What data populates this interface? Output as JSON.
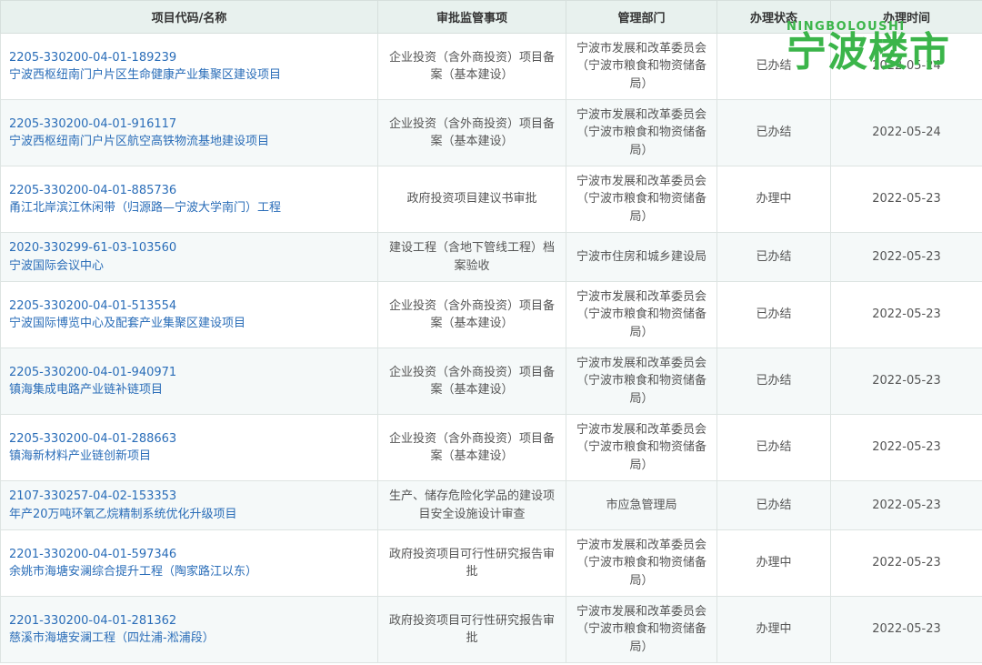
{
  "headers": [
    "项目代码/名称",
    "审批监管事项",
    "管理部门",
    "办理状态",
    "办理时间"
  ],
  "rows": [
    {
      "code": "2205-330200-04-01-189239",
      "name": "宁波西枢纽南门户片区生命健康产业集聚区建设项目",
      "item": "企业投资（含外商投资）项目备案（基本建设）",
      "dept": "宁波市发展和改革委员会（宁波市粮食和物资储备局）",
      "status": "已办结",
      "date": "2022-05-24"
    },
    {
      "code": "2205-330200-04-01-916117",
      "name": "宁波西枢纽南门户片区航空高铁物流基地建设项目",
      "item": "企业投资（含外商投资）项目备案（基本建设）",
      "dept": "宁波市发展和改革委员会（宁波市粮食和物资储备局）",
      "status": "已办结",
      "date": "2022-05-24"
    },
    {
      "code": "2205-330200-04-01-885736",
      "name": "甬江北岸滨江休闲带（归源路—宁波大学南门）工程",
      "item": "政府投资项目建议书审批",
      "dept": "宁波市发展和改革委员会（宁波市粮食和物资储备局）",
      "status": "办理中",
      "date": "2022-05-23"
    },
    {
      "code": "2020-330299-61-03-103560",
      "name": "宁波国际会议中心",
      "item": "建设工程（含地下管线工程）档案验收",
      "dept": "宁波市住房和城乡建设局",
      "status": "已办结",
      "date": "2022-05-23"
    },
    {
      "code": "2205-330200-04-01-513554",
      "name": "宁波国际博览中心及配套产业集聚区建设项目",
      "item": "企业投资（含外商投资）项目备案（基本建设）",
      "dept": "宁波市发展和改革委员会（宁波市粮食和物资储备局）",
      "status": "已办结",
      "date": "2022-05-23"
    },
    {
      "code": "2205-330200-04-01-940971",
      "name": "镇海集成电路产业链补链项目",
      "item": "企业投资（含外商投资）项目备案（基本建设）",
      "dept": "宁波市发展和改革委员会（宁波市粮食和物资储备局）",
      "status": "已办结",
      "date": "2022-05-23"
    },
    {
      "code": "2205-330200-04-01-288663",
      "name": "镇海新材料产业链创新项目",
      "item": "企业投资（含外商投资）项目备案（基本建设）",
      "dept": "宁波市发展和改革委员会（宁波市粮食和物资储备局）",
      "status": "已办结",
      "date": "2022-05-23"
    },
    {
      "code": "2107-330257-04-02-153353",
      "name": "年产20万吨环氧乙烷精制系统优化升级项目",
      "item": "生产、储存危险化学品的建设项目安全设施设计审查",
      "dept": "市应急管理局",
      "status": "已办结",
      "date": "2022-05-23"
    },
    {
      "code": "2201-330200-04-01-597346",
      "name": "余姚市海塘安澜综合提升工程（陶家路江以东）",
      "item": "政府投资项目可行性研究报告审批",
      "dept": "宁波市发展和改革委员会（宁波市粮食和物资储备局）",
      "status": "办理中",
      "date": "2022-05-23"
    },
    {
      "code": "2201-330200-04-01-281362",
      "name": "慈溪市海塘安澜工程（四灶浦-淞浦段）",
      "item": "政府投资项目可行性研究报告审批",
      "dept": "宁波市发展和改革委员会（宁波市粮食和物资储备局）",
      "status": "办理中",
      "date": "2022-05-23"
    }
  ],
  "watermark": {
    "latin": "NINGBOLOUSHI",
    "cn": "宁波楼市",
    "color": "#3bb54a"
  }
}
